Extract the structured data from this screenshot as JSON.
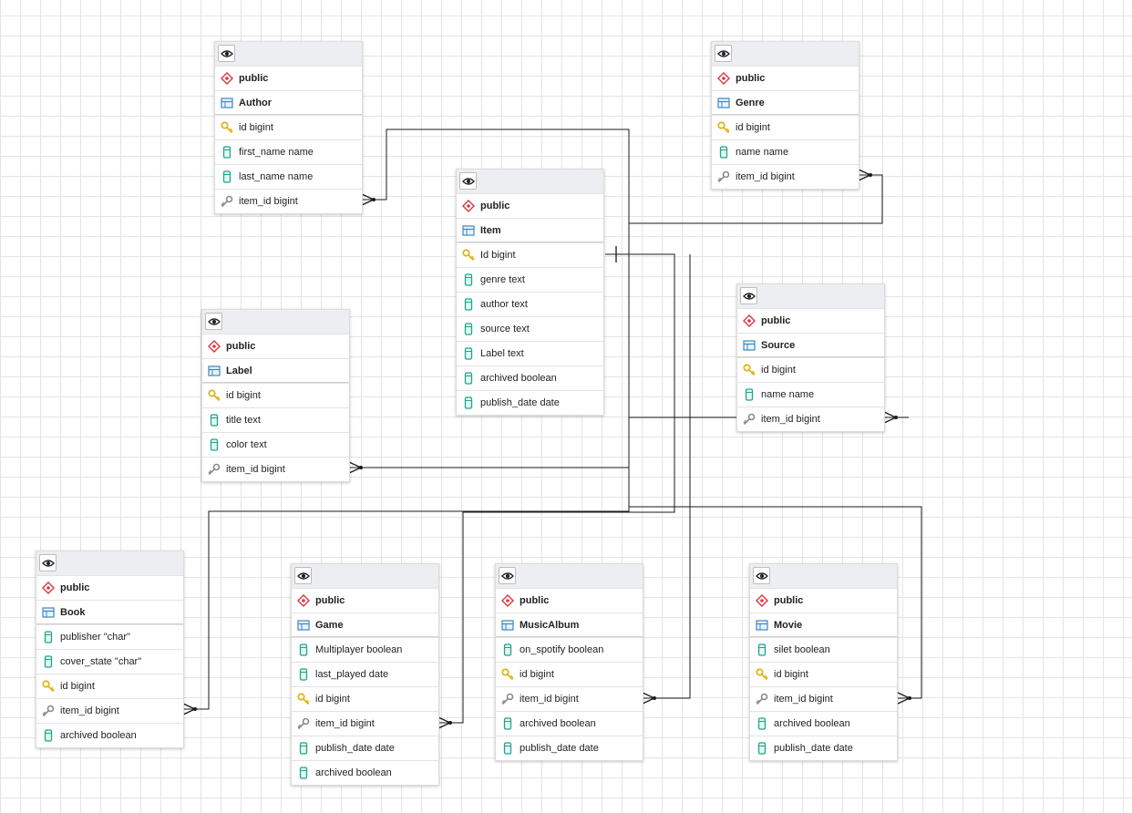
{
  "tables": [
    {
      "key": "author",
      "schema": "public",
      "name": "Author",
      "columns": [
        {
          "icon": "key-icon",
          "label": "id bigint"
        },
        {
          "icon": "column-icon",
          "label": "first_name name"
        },
        {
          "icon": "column-icon",
          "label": "last_name name"
        },
        {
          "icon": "foreign-key-icon",
          "label": "item_id bigint"
        }
      ]
    },
    {
      "key": "genre",
      "schema": "public",
      "name": "Genre",
      "columns": [
        {
          "icon": "key-icon",
          "label": "id bigint"
        },
        {
          "icon": "column-icon",
          "label": "name name"
        },
        {
          "icon": "foreign-key-icon",
          "label": "item_id bigint"
        }
      ]
    },
    {
      "key": "item",
      "schema": "public",
      "name": "Item",
      "columns": [
        {
          "icon": "key-icon",
          "label": "Id bigint"
        },
        {
          "icon": "column-icon",
          "label": "genre text"
        },
        {
          "icon": "column-icon",
          "label": "author text"
        },
        {
          "icon": "column-icon",
          "label": "source text"
        },
        {
          "icon": "column-icon",
          "label": "Label text"
        },
        {
          "icon": "column-icon",
          "label": "archived boolean"
        },
        {
          "icon": "column-icon",
          "label": "publish_date date"
        }
      ]
    },
    {
      "key": "source",
      "schema": "public",
      "name": "Source",
      "columns": [
        {
          "icon": "key-icon",
          "label": "id bigint"
        },
        {
          "icon": "column-icon",
          "label": "name name"
        },
        {
          "icon": "foreign-key-icon",
          "label": "item_id bigint"
        }
      ]
    },
    {
      "key": "label",
      "schema": "public",
      "name": "Label",
      "columns": [
        {
          "icon": "key-icon",
          "label": "id bigint"
        },
        {
          "icon": "column-icon",
          "label": "title text"
        },
        {
          "icon": "column-icon",
          "label": "color text"
        },
        {
          "icon": "foreign-key-icon",
          "label": "item_id bigint"
        }
      ]
    },
    {
      "key": "book",
      "schema": "public",
      "name": "Book",
      "columns": [
        {
          "icon": "column-icon",
          "label": "publisher \"char\""
        },
        {
          "icon": "column-icon",
          "label": "cover_state \"char\""
        },
        {
          "icon": "key-icon",
          "label": "id bigint"
        },
        {
          "icon": "foreign-key-icon",
          "label": "item_id bigint"
        },
        {
          "icon": "column-icon",
          "label": "archived boolean"
        }
      ]
    },
    {
      "key": "game",
      "schema": "public",
      "name": "Game",
      "columns": [
        {
          "icon": "column-icon",
          "label": "Multiplayer boolean"
        },
        {
          "icon": "column-icon",
          "label": "last_played date"
        },
        {
          "icon": "key-icon",
          "label": "id bigint"
        },
        {
          "icon": "foreign-key-icon",
          "label": "item_id bigint"
        },
        {
          "icon": "column-icon",
          "label": "publish_date date"
        },
        {
          "icon": "column-icon",
          "label": "archived boolean"
        }
      ]
    },
    {
      "key": "music-album",
      "schema": "public",
      "name": "MusicAlbum",
      "columns": [
        {
          "icon": "column-icon",
          "label": "on_spotify boolean"
        },
        {
          "icon": "key-icon",
          "label": "id bigint"
        },
        {
          "icon": "foreign-key-icon",
          "label": "item_id bigint"
        },
        {
          "icon": "column-icon",
          "label": "archived boolean"
        },
        {
          "icon": "column-icon",
          "label": "publish_date date"
        }
      ]
    },
    {
      "key": "movie",
      "schema": "public",
      "name": "Movie",
      "columns": [
        {
          "icon": "column-icon",
          "label": "silet boolean"
        },
        {
          "icon": "key-icon",
          "label": "id bigint"
        },
        {
          "icon": "foreign-key-icon",
          "label": "item_id bigint"
        },
        {
          "icon": "column-icon",
          "label": "archived boolean"
        },
        {
          "icon": "column-icon",
          "label": "publish_date date"
        }
      ]
    }
  ],
  "relationships": [
    {
      "from": "author",
      "to": "item"
    },
    {
      "from": "genre",
      "to": "item"
    },
    {
      "from": "source",
      "to": "item"
    },
    {
      "from": "label",
      "to": "item"
    },
    {
      "from": "book",
      "to": "item"
    },
    {
      "from": "game",
      "to": "item"
    },
    {
      "from": "music-album",
      "to": "item"
    },
    {
      "from": "movie",
      "to": "item"
    }
  ],
  "colors": {
    "schema_icon": "#d9363e",
    "table_icon": "#3c86c6",
    "key_icon": "#e2b418",
    "column_icon": "#1fa58d",
    "foreign_key_icon": "#8a8a8a",
    "link_line": "#1a1a1a"
  }
}
